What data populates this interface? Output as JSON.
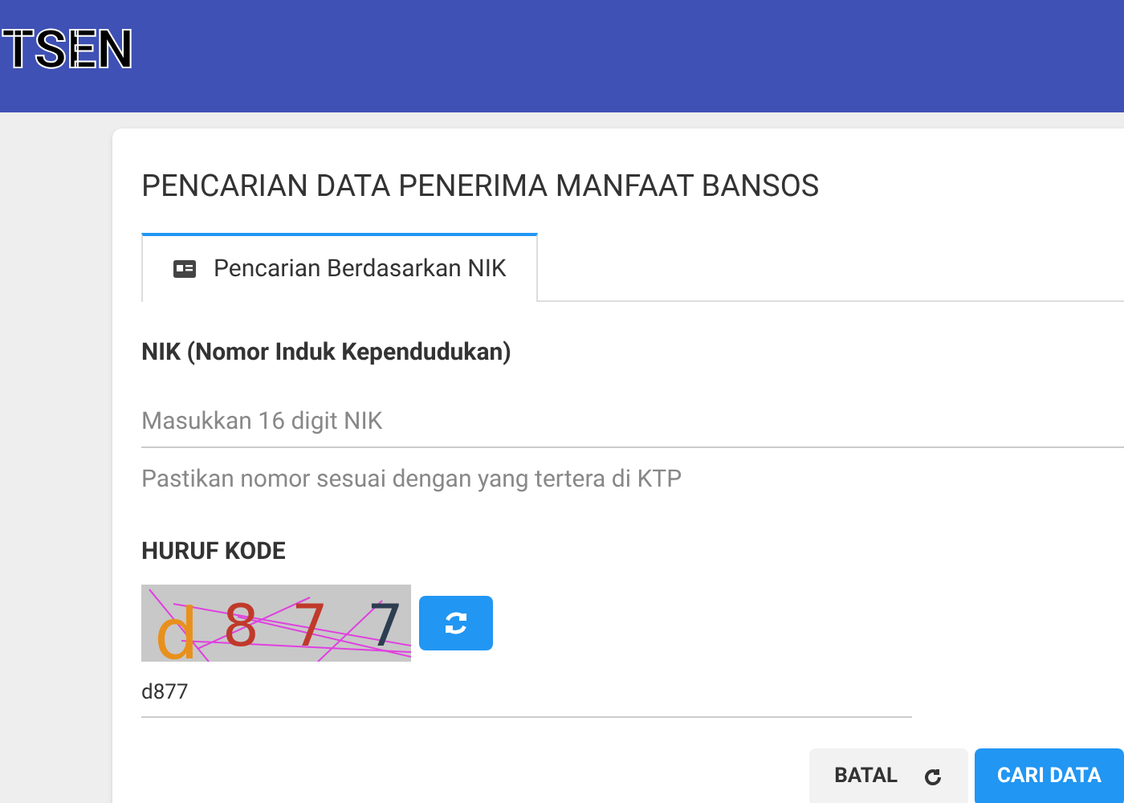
{
  "header": {
    "logo_text": "TSEN"
  },
  "card": {
    "title": "PENCARIAN DATA PENERIMA MANFAAT BANSOS",
    "tabs": [
      {
        "label": "Pencarian Berdasarkan NIK",
        "selected": true
      }
    ],
    "nik": {
      "label": "NIK (Nomor Induk Kependudukan)",
      "placeholder": "Masukkan 16 digit NIK",
      "hint": "Pastikan nomor sesuai dengan yang tertera di KTP"
    },
    "captcha": {
      "label": "HURUF KODE",
      "characters": [
        {
          "char": "d",
          "color": "#e8901c"
        },
        {
          "char": "8",
          "color": "#c0392b"
        },
        {
          "char": "7",
          "color": "#c0392b"
        },
        {
          "char": "7",
          "color": "#2c3e50"
        }
      ],
      "value": "d877"
    },
    "buttons": [
      {
        "kind": "secondary",
        "label": "BATAL"
      },
      {
        "kind": "primary",
        "label": "CARI DATA"
      }
    ]
  }
}
